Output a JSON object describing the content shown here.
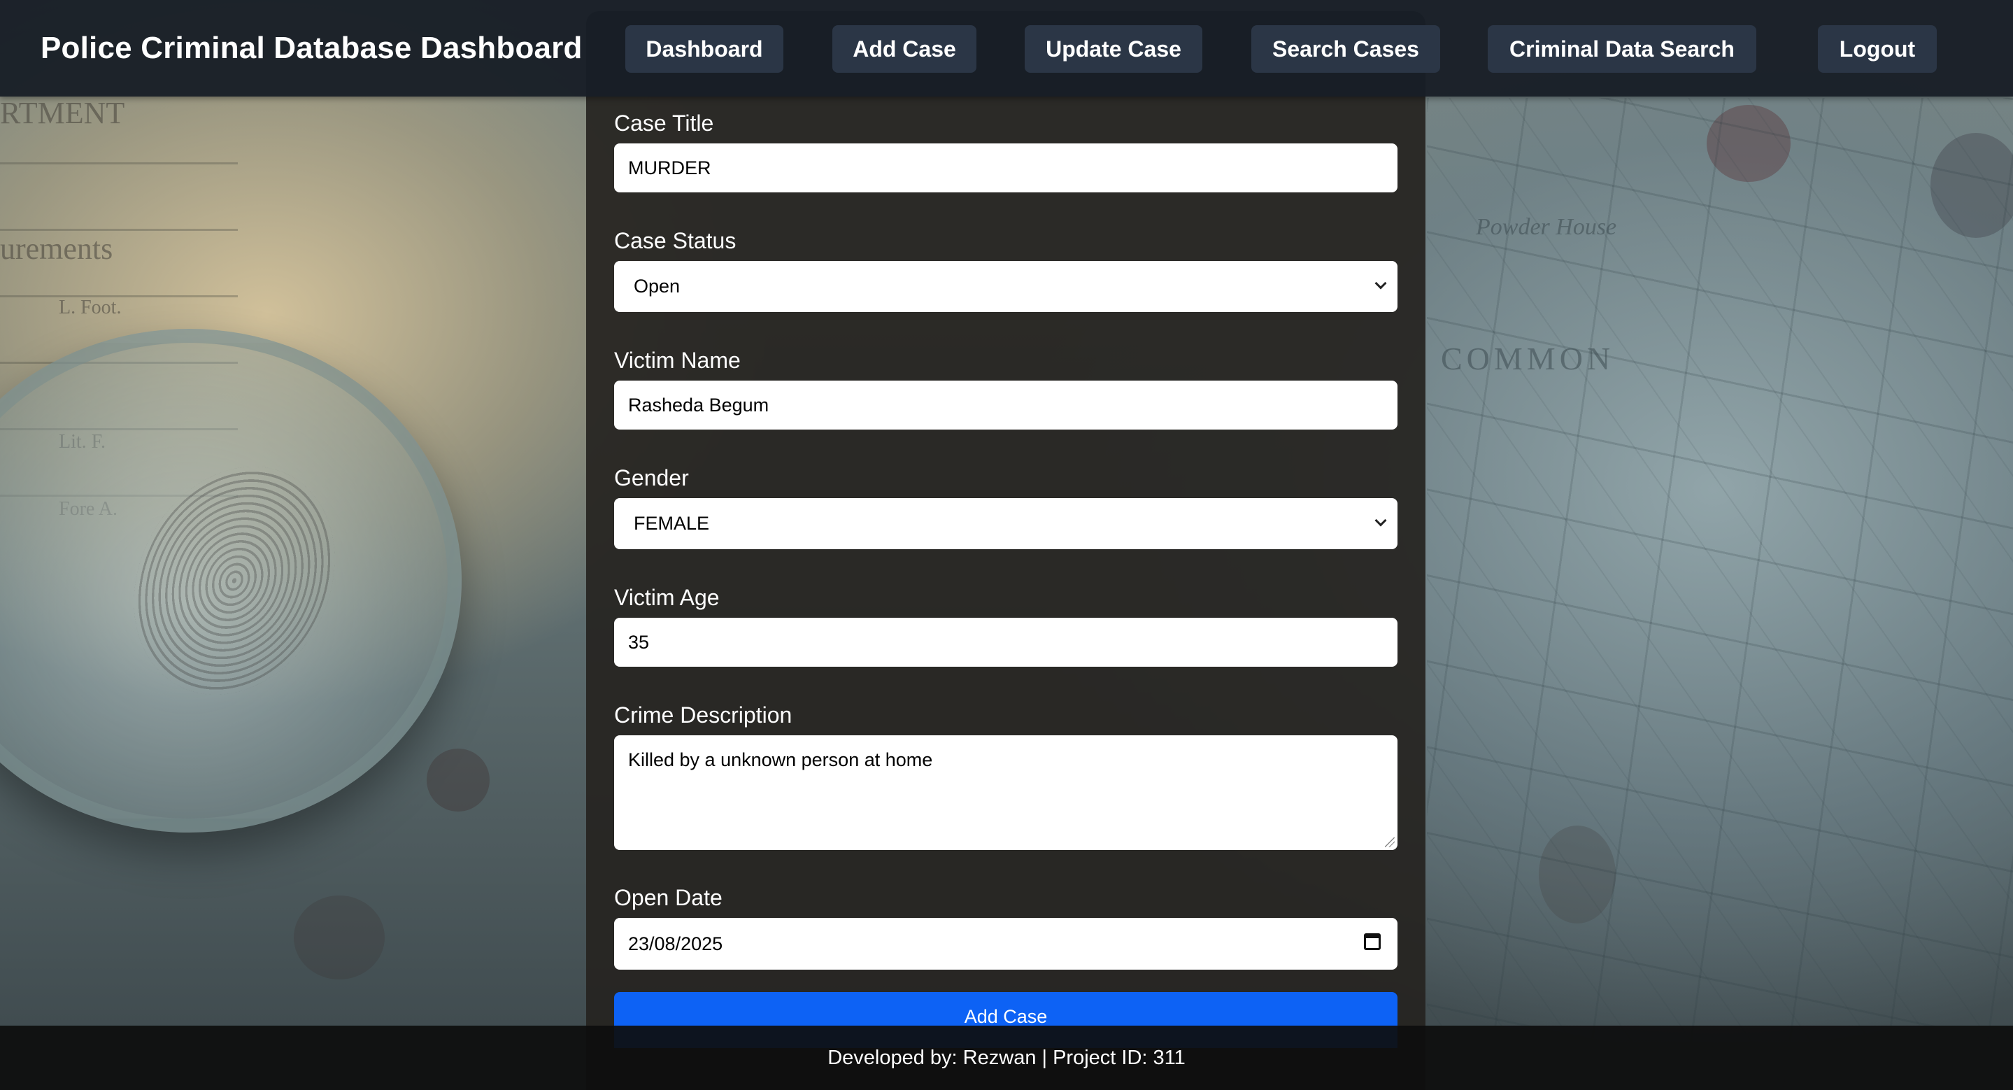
{
  "header": {
    "title": "Police Criminal Database Dashboard",
    "nav": {
      "dashboard": "Dashboard",
      "add_case": "Add Case",
      "update_case": "Update Case",
      "search_cases": "Search Cases",
      "criminal_data_search": "Criminal Data Search",
      "logout": "Logout"
    }
  },
  "form": {
    "case_title": {
      "label": "Case Title",
      "value": "MURDER"
    },
    "case_status": {
      "label": "Case Status",
      "value": "Open"
    },
    "victim_name": {
      "label": "Victim Name",
      "value": "Rasheda Begum"
    },
    "gender": {
      "label": "Gender",
      "value": "FEMALE"
    },
    "victim_age": {
      "label": "Victim Age",
      "value": "35"
    },
    "crime_description": {
      "label": "Crime Description",
      "value": "Killed by a unknown person at home"
    },
    "open_date": {
      "label": "Open Date",
      "value": "23/08/2025"
    },
    "submit_label": "Add Case"
  },
  "footer": {
    "text": "Developed by: Rezwan | Project ID: 311"
  },
  "colors": {
    "nav_bg": "#181e26",
    "nav_button": "#2b3646",
    "panel_bg": "#262420",
    "primary": "#0d62f5"
  }
}
